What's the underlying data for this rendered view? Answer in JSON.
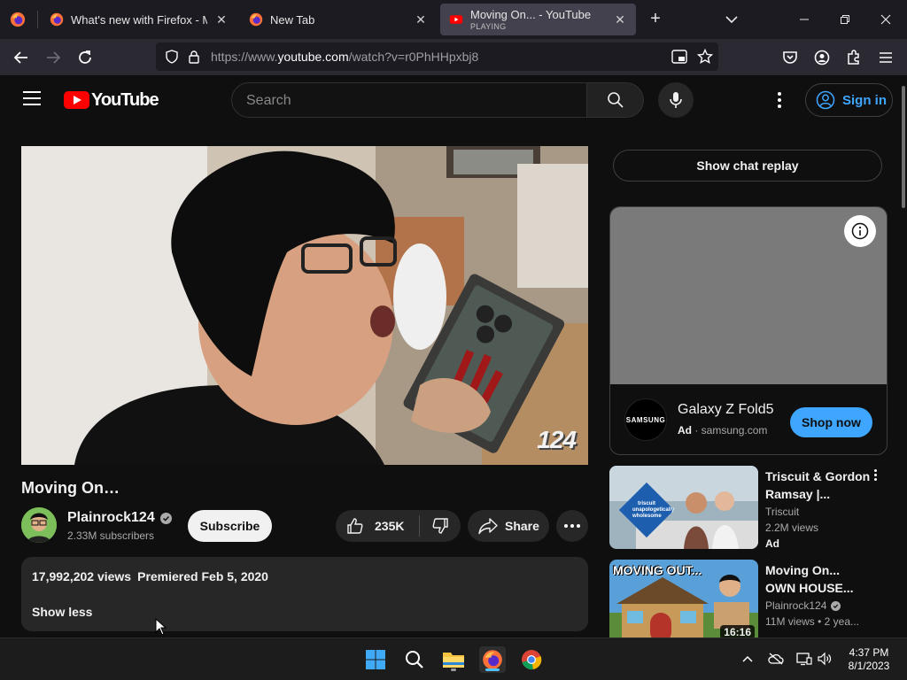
{
  "browser": {
    "tabs": [
      {
        "title": "What's new with Firefox - More",
        "subtitle": "",
        "active": false
      },
      {
        "title": "New Tab",
        "subtitle": "",
        "active": false
      },
      {
        "title": "Moving On... - YouTube",
        "subtitle": "PLAYING",
        "active": true
      }
    ],
    "new_tab_label": "+",
    "url": {
      "prefix": "https://www.",
      "host": "youtube.com",
      "path": "/watch?v=r0PhHHpxbj8"
    }
  },
  "youtube": {
    "logo_text": "YouTube",
    "search_placeholder": "Search",
    "sign_in_label": "Sign in",
    "video": {
      "title": "Moving On…",
      "watermark": "124",
      "channel_name": "Plainrock124",
      "subscribers": "2.33M subscribers",
      "subscribe_label": "Subscribe",
      "likes": "235K",
      "share_label": "Share",
      "views": "17,992,202 views",
      "premiered": "Premiered Feb 5, 2020",
      "show_less_label": "Show less"
    },
    "sidebar": {
      "chat_replay_label": "Show chat replay",
      "ad": {
        "logo_text": "SAMSUNG",
        "title": "Galaxy Z Fold5",
        "ad_label": "Ad",
        "domain": "· samsung.com",
        "cta": "Shop now"
      },
      "recommendations": [
        {
          "title": "Triscuit & Gordon Ramsay |...",
          "channel": "Triscuit",
          "stats": "2.2M views",
          "ad_label": "Ad",
          "thumb_text": "triscuit unapologetically wholesome",
          "duration": ""
        },
        {
          "title": "Moving On... OWN HOUSE...",
          "channel": "Plainrock124",
          "stats": "11M views • 2 yea...",
          "ad_label": "",
          "thumb_text": "MOVING OUT...",
          "duration": "16:16"
        }
      ]
    }
  },
  "taskbar": {
    "time": "4:37 PM",
    "date": "8/1/2023"
  },
  "colors": {
    "yt_red": "#ff0000",
    "link_blue": "#3ea6ff",
    "tab_active": "#42414d",
    "firefox_orange": "#ff7139"
  }
}
